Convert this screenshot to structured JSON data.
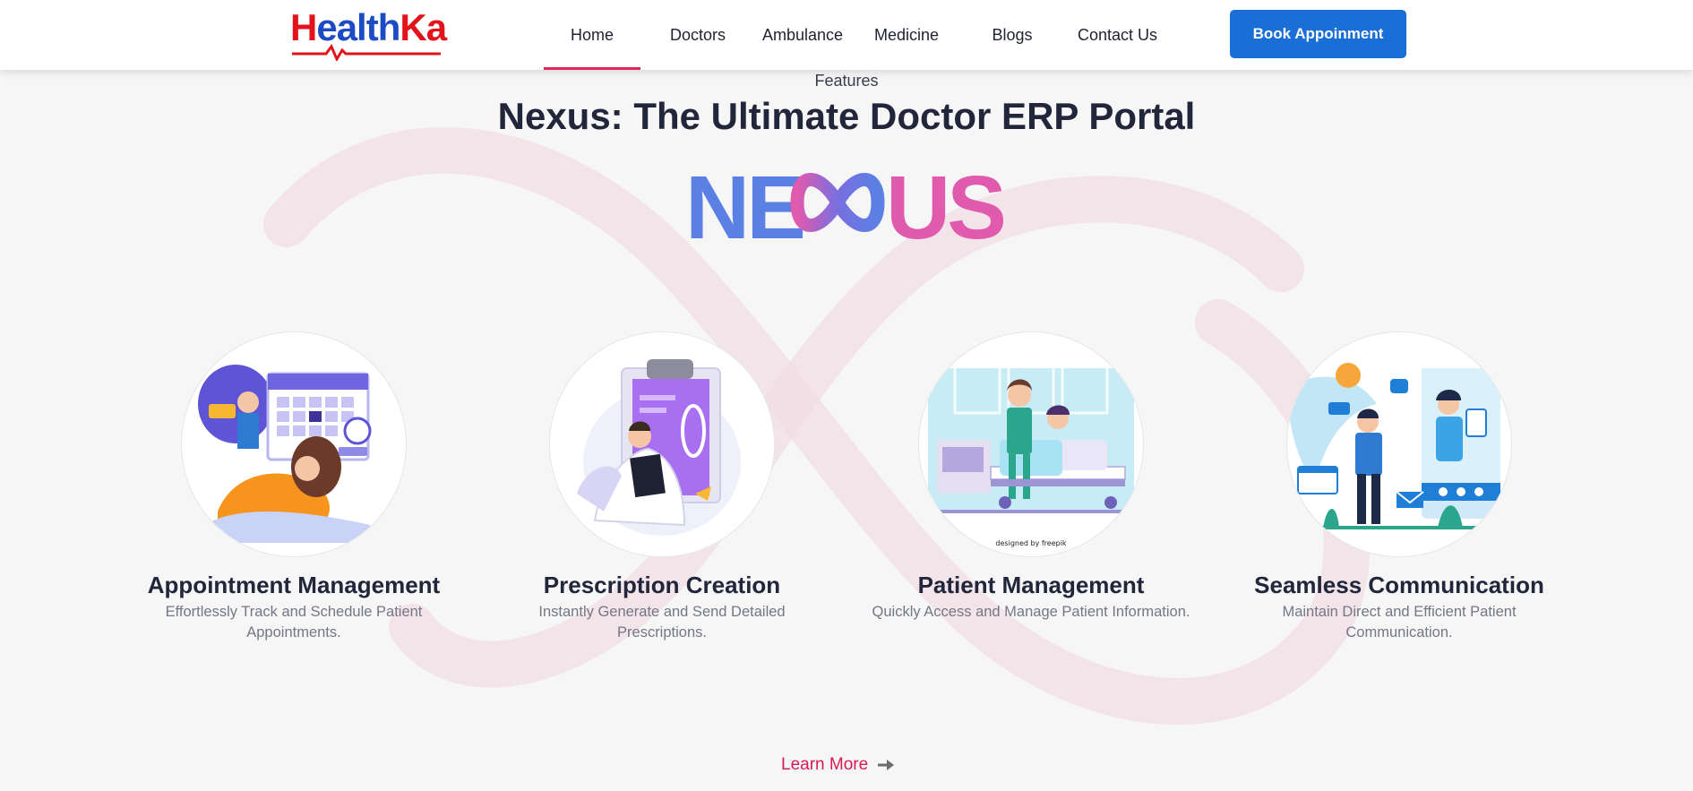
{
  "brand": {
    "logo_h": "H",
    "logo_mid": "ealth",
    "logo_k": "Ka",
    "colors": {
      "red": "#e1141b",
      "blue": "#1d4bc5"
    }
  },
  "nav": {
    "items": [
      {
        "label": "Home",
        "active": true
      },
      {
        "label": "Doctors",
        "active": false
      },
      {
        "label": "Ambulance",
        "active": false
      },
      {
        "label": "Medicine",
        "active": false
      },
      {
        "label": "Blogs",
        "active": false
      },
      {
        "label": "Contact Us",
        "active": false
      }
    ],
    "cta_label": "Book Appoinment",
    "active_underline_color": "#e0245e",
    "cta_color": "#1a6fd6"
  },
  "hero": {
    "eyebrow": "Features",
    "title": "Nexus: The Ultimate Doctor ERP Portal",
    "product_logo": {
      "left_text": "NE",
      "right_text": "US",
      "colors": {
        "blue": "#5b80e4",
        "pink": "#e05aad"
      }
    }
  },
  "features": [
    {
      "icon": "calendar-appointment-illustration",
      "title": "Appointment Management",
      "description": "Effortlessly Track and Schedule Patient Appointments."
    },
    {
      "icon": "prescription-clipboard-illustration",
      "title": "Prescription Creation",
      "description": "Instantly Generate and Send Detailed Prescriptions."
    },
    {
      "icon": "hospital-bed-patient-illustration",
      "title": "Patient Management",
      "description": "Quickly Access and Manage Patient Information.",
      "credit": "designed by freepik"
    },
    {
      "icon": "video-call-communication-illustration",
      "title": "Seamless Communication",
      "description": "Maintain Direct and Efficient Patient Communication."
    }
  ],
  "learn_more": {
    "label": "Learn More",
    "icon": "arrow-right-icon",
    "color": "#d81b55"
  }
}
